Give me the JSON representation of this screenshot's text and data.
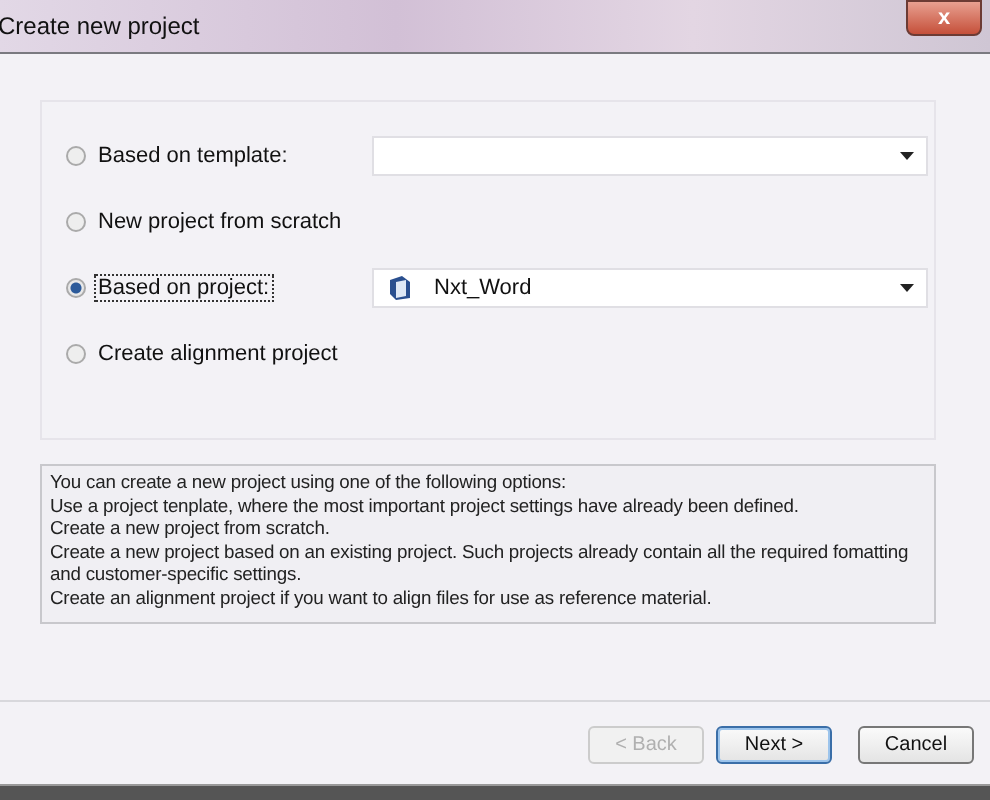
{
  "window": {
    "title": "Create new project",
    "close": "x"
  },
  "options": [
    {
      "label": "Based on template:",
      "selected": false,
      "kind": "combo"
    },
    {
      "label": "New project from scratch",
      "selected": false,
      "kind": "plain"
    },
    {
      "label": "Based on project:",
      "selected": true,
      "kind": "combo",
      "value": "Nxt_Word"
    },
    {
      "label": "Create alignment project",
      "selected": false,
      "kind": "plain"
    }
  ],
  "description": [
    "You can create a new project using one of the following options:",
    "Use a project tenplate, where the most important project settings have already been defined.",
    "Create a new project from scratch.",
    "Create a new project based on an existing project. Such projects already contain all the required fomatting and customer-specific settings.",
    "Create an alignment project if you want to align files for use as reference material."
  ],
  "buttons": [
    {
      "label": "< Back",
      "disabled": true,
      "default": false
    },
    {
      "label": "Next >",
      "disabled": false,
      "default": true
    },
    {
      "label": "Cancel",
      "disabled": false,
      "default": false
    }
  ]
}
